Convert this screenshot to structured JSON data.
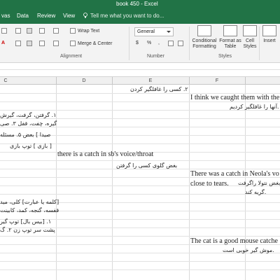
{
  "window": {
    "title": "book 450 - Excel"
  },
  "tabs": [
    {
      "label": "vas"
    },
    {
      "label": "Data"
    },
    {
      "label": "Review"
    },
    {
      "label": "View"
    }
  ],
  "tell_me": {
    "placeholder": "Tell me what you want to do..."
  },
  "ribbon": {
    "wrap_text": "Wrap Text",
    "merge_center": "Merge & Center",
    "number_format": "General",
    "currency": "$",
    "percent": "%",
    "comma": ",",
    "conditional_formatting": "Conditional Formatting",
    "format_as_table": "Format as Table",
    "cell_styles": "Cell Styles",
    "insert": "Insert",
    "groups": {
      "alignment": "Alignment",
      "number": "Number",
      "styles": "Styles"
    }
  },
  "columns": [
    "C",
    "D",
    "E",
    "F"
  ],
  "cells": {
    "e_r1": "۲. کسی را غافلگیر کردن",
    "f_r2": "I think we caught them with the",
    "f_r3": ".آنها را غافلگیر کردیم",
    "b_r4": "۱. گرفتن، گرفت، گیرش",
    "b_r5": "گیره، چفت، قفل ۳. صی",
    "b_r6": "صیدا ] بعض ۵. مسئله",
    "b_r7": "[ بازی ] توپ بازی",
    "d_r8": "there is a catch in sb's voice/throat",
    "d_r9": "بغض گلوی کسی را گرفتن",
    "f_r10": "There was a catch in Neola's vo",
    "f_r11": "بغض نتولا راگرفت",
    "f_r12": "close to tears.",
    "f_r12b": ".گریه کند",
    "b_r13": "[کلمه یا عبارت] کلی، مید",
    "b_r14": "قفسه، گنجه، کمد، کابینت",
    "b_r15": "۱. [بیس بال] توپ گیر",
    "b_r16": "پشت سر توپ زن ۲. گ",
    "f_r17": "The cat is a good mouse catche",
    "f_r18": ".موش گیر خوبی است"
  }
}
